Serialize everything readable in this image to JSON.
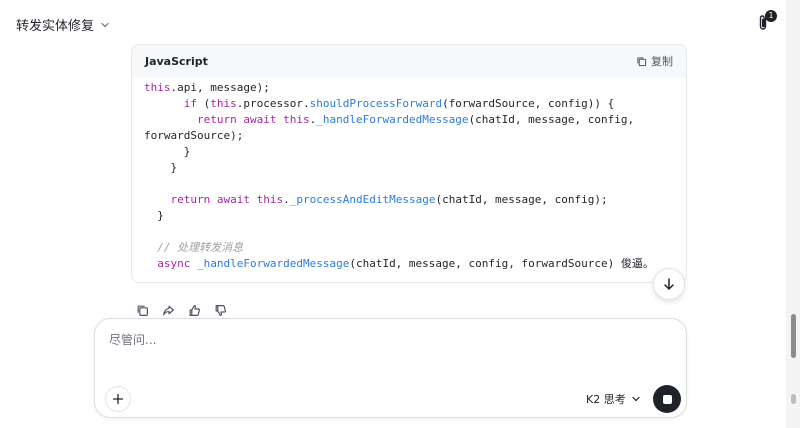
{
  "header": {
    "title": "转发实体修复",
    "attachment_count": "1"
  },
  "code_block": {
    "language": "JavaScript",
    "copy_label": "复制",
    "lines": [
      [
        {
          "t": "this",
          "c": "kw"
        },
        {
          "t": ".api, message);",
          "c": ""
        }
      ],
      [
        {
          "t": "      ",
          "c": ""
        },
        {
          "t": "if",
          "c": "kw"
        },
        {
          "t": " (",
          "c": ""
        },
        {
          "t": "this",
          "c": "kw"
        },
        {
          "t": ".processor.",
          "c": ""
        },
        {
          "t": "shouldProcessForward",
          "c": "fn"
        },
        {
          "t": "(forwardSource, config)) {",
          "c": ""
        }
      ],
      [
        {
          "t": "        ",
          "c": ""
        },
        {
          "t": "return",
          "c": "kw"
        },
        {
          "t": " ",
          "c": ""
        },
        {
          "t": "await",
          "c": "kw"
        },
        {
          "t": " ",
          "c": ""
        },
        {
          "t": "this",
          "c": "kw"
        },
        {
          "t": ".",
          "c": ""
        },
        {
          "t": "_handleForwardedMessage",
          "c": "fn"
        },
        {
          "t": "(chatId, message, config,",
          "c": ""
        }
      ],
      [
        {
          "t": "forwardSource);",
          "c": ""
        }
      ],
      [
        {
          "t": "      }",
          "c": ""
        }
      ],
      [
        {
          "t": "    }",
          "c": ""
        }
      ],
      [
        {
          "t": "",
          "c": ""
        }
      ],
      [
        {
          "t": "    ",
          "c": ""
        },
        {
          "t": "return",
          "c": "kw"
        },
        {
          "t": " ",
          "c": ""
        },
        {
          "t": "await",
          "c": "kw"
        },
        {
          "t": " ",
          "c": ""
        },
        {
          "t": "this",
          "c": "kw"
        },
        {
          "t": ".",
          "c": ""
        },
        {
          "t": "_processAndEditMessage",
          "c": "fn"
        },
        {
          "t": "(chatId, message, config);",
          "c": ""
        }
      ],
      [
        {
          "t": "  }",
          "c": ""
        }
      ],
      [
        {
          "t": "",
          "c": ""
        }
      ],
      [
        {
          "t": "  ",
          "c": ""
        },
        {
          "t": "// 处理转发消息",
          "c": "cm"
        }
      ],
      [
        {
          "t": "  ",
          "c": ""
        },
        {
          "t": "async",
          "c": "kw"
        },
        {
          "t": " ",
          "c": ""
        },
        {
          "t": "_handleForwardedMessage",
          "c": "fn"
        },
        {
          "t": "(chatId, message, config, forwardSource) 俊逼。",
          "c": ""
        }
      ]
    ]
  },
  "composer": {
    "placeholder": "尽管问...",
    "model_label": "K2 思考"
  },
  "icons": {
    "copy": "copy-icon",
    "share": "share-icon",
    "like": "thumbs-up-icon",
    "dislike": "thumbs-down-icon",
    "attach": "paperclip-icon",
    "scroll_down": "arrow-down-icon",
    "add": "plus-icon",
    "stop": "stop-icon"
  }
}
